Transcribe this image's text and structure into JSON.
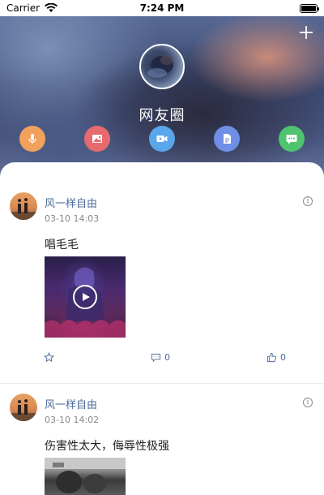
{
  "status_bar": {
    "carrier": "Carrier",
    "time": "7:24 PM"
  },
  "header": {
    "title": "网友圈",
    "add_icon": "plus-icon"
  },
  "actions": [
    {
      "name": "mic",
      "icon": "microphone-icon",
      "color": "#f2a15c"
    },
    {
      "name": "image",
      "icon": "image-icon",
      "color": "#e76a6f"
    },
    {
      "name": "video",
      "icon": "video-camera-icon",
      "color": "#5aa6ea"
    },
    {
      "name": "document",
      "icon": "document-icon",
      "color": "#6f8ee6"
    },
    {
      "name": "message",
      "icon": "chat-bubble-icon",
      "color": "#4fc36f"
    }
  ],
  "posts": [
    {
      "author": "风一样自由",
      "time": "03-10 14:03",
      "text": "唱毛毛",
      "media": "video",
      "comments": "0",
      "likes": "0"
    },
    {
      "author": "风一样自由",
      "time": "03-10 14:02",
      "text": "伤害性太大，侮辱性极强",
      "media": "image"
    }
  ],
  "colors": {
    "link": "#4a6b9a",
    "accent_text": "#222222"
  }
}
